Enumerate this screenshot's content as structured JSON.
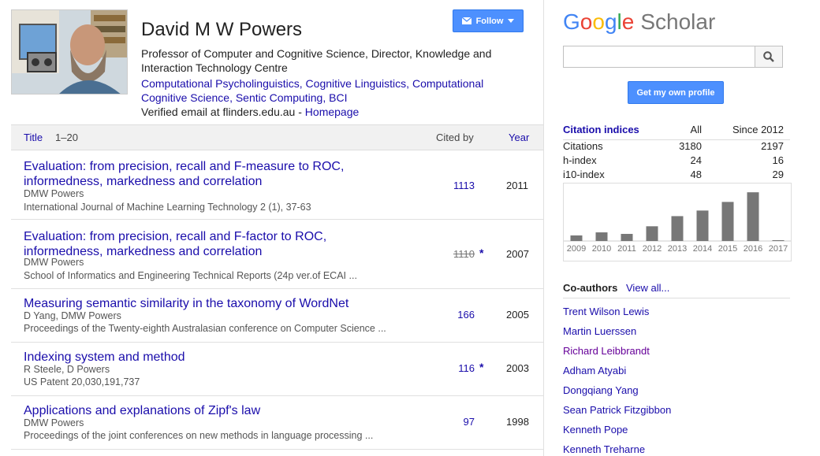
{
  "profile": {
    "name": "David M W Powers",
    "affiliation": "Professor of Computer and Cognitive Science, Director, Knowledge and Interaction Technology Centre",
    "interests": [
      "Computational Psycholinguistics",
      "Computational Cognitive Science",
      "Cognitive Linguistics",
      "Sentic Computing",
      "BCI"
    ],
    "interests_line1": [
      "Computational Psycholinguistics",
      "Cognitive Linguistics",
      "Computational"
    ],
    "interests_line2": [
      "Cognitive Science",
      "Sentic Computing",
      "BCI"
    ],
    "email_text": "Verified email at flinders.edu.au",
    "email_sep": " - ",
    "homepage_label": "Homepage",
    "follow_label": "Follow"
  },
  "table": {
    "header": {
      "title": "Title",
      "range": "1–20",
      "cited_by": "Cited by",
      "year": "Year"
    },
    "rows": [
      {
        "title": "Evaluation: from precision, recall and F-measure to ROC, informedness, markedness and correlation",
        "authors": "DMW Powers",
        "venue": "International Journal of Machine Learning Technology 2 (1), 37-63",
        "cited": "1113",
        "star": "",
        "year": "2011"
      },
      {
        "title": "Evaluation: from precision, recall and F-factor to ROC, informedness, markedness and correlation",
        "authors": "DMW Powers",
        "venue": "School of Informatics and Engineering Technical Reports (24p ver.of ECAI ...",
        "cited": "1110",
        "star": "*",
        "year": "2007"
      },
      {
        "title": "Measuring semantic similarity in the taxonomy of WordNet",
        "authors": "D Yang, DMW Powers",
        "venue": "Proceedings of the Twenty-eighth Australasian conference on Computer Science ...",
        "cited": "166",
        "star": "",
        "year": "2005"
      },
      {
        "title": "Indexing system and method",
        "authors": "R Steele, D Powers",
        "venue": "US Patent 20,030,191,737",
        "cited": "116",
        "star": "*",
        "year": "2003"
      },
      {
        "title": "Applications and explanations of Zipf's law",
        "authors": "DMW Powers",
        "venue": "Proceedings of the joint conferences on new methods in language processing ...",
        "cited": "97",
        "star": "",
        "year": "1998"
      }
    ]
  },
  "scholar": {
    "logo_letters": [
      "G",
      "o",
      "o",
      "g",
      "l",
      "e"
    ],
    "logo_word": "Scholar",
    "search_placeholder": "",
    "own_profile_label": "Get my own profile"
  },
  "citation_indices": {
    "title": "Citation indices",
    "col_all": "All",
    "col_since": "Since 2012",
    "rows": [
      {
        "label": "Citations",
        "all": "3180",
        "since": "2197"
      },
      {
        "label": "h-index",
        "all": "24",
        "since": "16"
      },
      {
        "label": "i10-index",
        "all": "48",
        "since": "29"
      }
    ]
  },
  "chart_data": {
    "type": "bar",
    "categories": [
      "2009",
      "2010",
      "2011",
      "2012",
      "2013",
      "2014",
      "2015",
      "2016",
      "2017"
    ],
    "values": [
      55,
      85,
      70,
      145,
      245,
      300,
      385,
      480,
      8
    ],
    "ylim": [
      0,
      520
    ],
    "color": "#777777",
    "grid": false
  },
  "coauthors": {
    "title": "Co-authors",
    "view_all": "View all...",
    "names": [
      "Trent Wilson Lewis",
      "Martin Luerssen",
      "Richard Leibbrandt",
      "Adham Atyabi",
      "Dongqiang Yang",
      "Sean Patrick Fitzgibbon",
      "Kenneth Pope",
      "Kenneth Treharne"
    ]
  }
}
